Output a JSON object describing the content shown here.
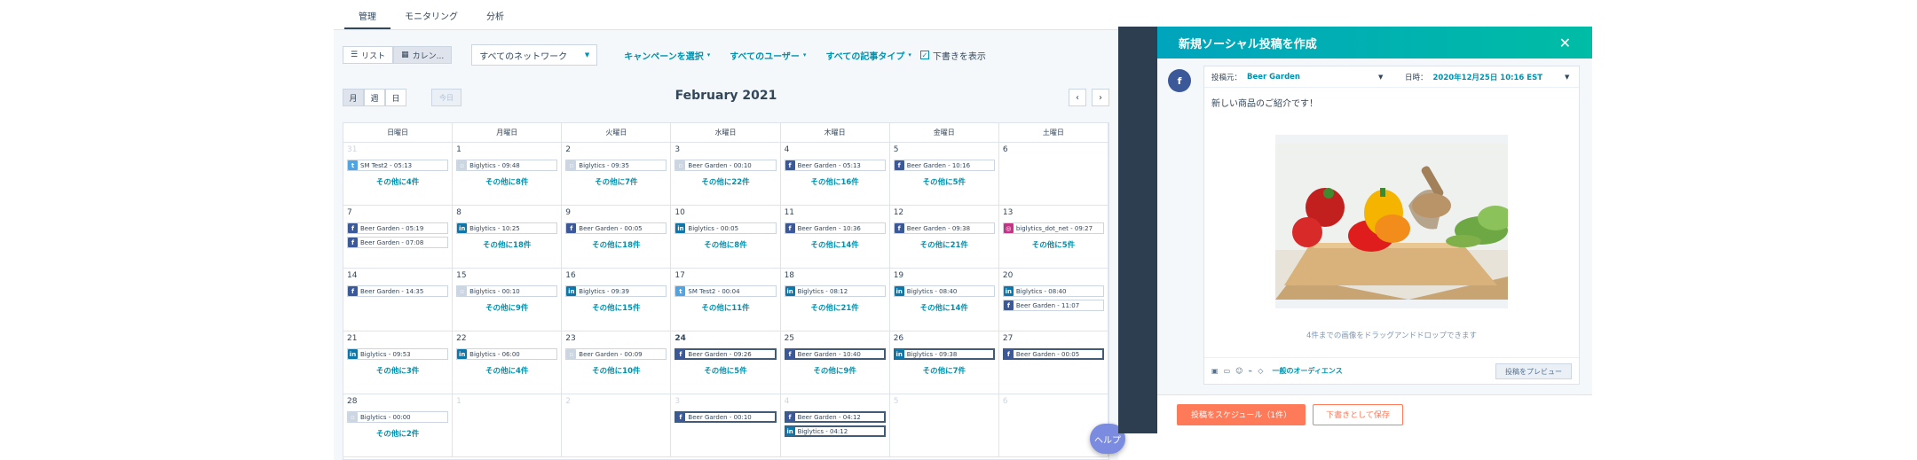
{
  "tabs": [
    {
      "label": "管理"
    },
    {
      "label": "モニタリング"
    },
    {
      "label": "分析"
    }
  ],
  "toolbar": {
    "view_list": "リスト",
    "view_calendar": "カレン...",
    "network": "すべてのネットワーク",
    "campaign": "キャンペーンを選択",
    "users": "すべてのユーザー",
    "post_types": "すべての記事タイプ",
    "show_drafts": "下書きを表示",
    "range_month": "月",
    "range_week": "週",
    "range_day": "日",
    "today": "今日",
    "month_title": "February 2021"
  },
  "weekdays": [
    "日曜日",
    "月曜日",
    "火曜日",
    "水曜日",
    "木曜日",
    "金曜日",
    "土曜日"
  ],
  "calendar": [
    {
      "num": "31",
      "muted": true,
      "posts": [
        {
          "icon": "tw",
          "text": "SM Test2 - 05:13"
        }
      ],
      "more": "その他に4件"
    },
    {
      "num": "1",
      "posts": [
        {
          "icon": "off",
          "text": "Biglytics - 09:48"
        }
      ],
      "more": "その他に8件"
    },
    {
      "num": "2",
      "posts": [
        {
          "icon": "off",
          "text": "Biglytics - 09:35"
        }
      ],
      "more": "その他に7件"
    },
    {
      "num": "3",
      "posts": [
        {
          "icon": "off",
          "text": "Beer Garden - 00:10"
        }
      ],
      "more": "その他に22件"
    },
    {
      "num": "4",
      "posts": [
        {
          "icon": "fb",
          "text": "Beer Garden - 05:13"
        }
      ],
      "more": "その他に16件"
    },
    {
      "num": "5",
      "posts": [
        {
          "icon": "fb",
          "text": "Beer Garden - 10:16"
        }
      ],
      "more": "その他に5件"
    },
    {
      "num": "6",
      "posts": [],
      "more": ""
    },
    {
      "num": "7",
      "posts": [
        {
          "icon": "fb",
          "text": "Beer Garden - 05:19"
        },
        {
          "icon": "fb",
          "text": "Beer Garden - 07:08"
        }
      ],
      "more": ""
    },
    {
      "num": "8",
      "posts": [
        {
          "icon": "li",
          "text": "Biglytics - 10:25"
        }
      ],
      "more": "その他に18件"
    },
    {
      "num": "9",
      "posts": [
        {
          "icon": "fb",
          "text": "Beer Garden - 00:05"
        }
      ],
      "more": "その他に18件"
    },
    {
      "num": "10",
      "posts": [
        {
          "icon": "li",
          "text": "Biglytics - 00:05"
        }
      ],
      "more": "その他に8件"
    },
    {
      "num": "11",
      "posts": [
        {
          "icon": "fb",
          "text": "Beer Garden - 10:36"
        }
      ],
      "more": "その他に14件"
    },
    {
      "num": "12",
      "posts": [
        {
          "icon": "fb",
          "text": "Beer Garden - 09:38"
        }
      ],
      "more": "その他に21件"
    },
    {
      "num": "13",
      "posts": [
        {
          "icon": "ig",
          "text": "biglytics_dot_net - 09:27"
        }
      ],
      "more": "その他に5件"
    },
    {
      "num": "14",
      "posts": [
        {
          "icon": "fb",
          "text": "Beer Garden - 14:35"
        }
      ],
      "more": ""
    },
    {
      "num": "15",
      "posts": [
        {
          "icon": "off",
          "text": "Biglytics - 00:10"
        }
      ],
      "more": "その他に9件"
    },
    {
      "num": "16",
      "posts": [
        {
          "icon": "li",
          "text": "Biglytics - 09:39"
        }
      ],
      "more": "その他に15件"
    },
    {
      "num": "17",
      "posts": [
        {
          "icon": "tw",
          "text": "SM Test2 - 00:04"
        }
      ],
      "more": "その他に11件"
    },
    {
      "num": "18",
      "posts": [
        {
          "icon": "li",
          "text": "Biglytics - 08:12"
        }
      ],
      "more": "その他に21件"
    },
    {
      "num": "19",
      "posts": [
        {
          "icon": "li",
          "text": "Biglytics - 08:40"
        }
      ],
      "more": "その他に14件"
    },
    {
      "num": "20",
      "posts": [
        {
          "icon": "li",
          "text": "Biglytics - 08:40"
        },
        {
          "icon": "fb",
          "text": "Beer Garden - 11:07"
        }
      ],
      "more": ""
    },
    {
      "num": "21",
      "posts": [
        {
          "icon": "li",
          "text": "Biglytics - 09:53"
        }
      ],
      "more": "その他に3件"
    },
    {
      "num": "22",
      "posts": [
        {
          "icon": "li",
          "text": "Biglytics - 06:00"
        }
      ],
      "more": "その他に4件"
    },
    {
      "num": "23",
      "posts": [
        {
          "icon": "off",
          "text": "Beer Garden - 00:09"
        }
      ],
      "more": "その他に10件"
    },
    {
      "num": "24",
      "bold": true,
      "posts": [
        {
          "icon": "fb",
          "text": "Beer Garden - 09:26",
          "sel": true
        }
      ],
      "more": "その他に5件"
    },
    {
      "num": "25",
      "posts": [
        {
          "icon": "fb",
          "text": "Beer Garden - 10:40",
          "sel": true
        }
      ],
      "more": "その他に9件"
    },
    {
      "num": "26",
      "posts": [
        {
          "icon": "li",
          "text": "Biglytics - 09:38",
          "sel": true
        }
      ],
      "more": "その他に7件"
    },
    {
      "num": "27",
      "posts": [
        {
          "icon": "fb",
          "text": "Beer Garden - 00:05",
          "sel": true
        }
      ],
      "more": ""
    },
    {
      "num": "28",
      "posts": [
        {
          "icon": "off",
          "text": "Biglytics - 00:00"
        }
      ],
      "more": "その他に2件"
    },
    {
      "num": "1",
      "muted": true,
      "posts": [],
      "more": ""
    },
    {
      "num": "2",
      "muted": true,
      "posts": [],
      "more": ""
    },
    {
      "num": "3",
      "muted": true,
      "posts": [
        {
          "icon": "fb",
          "text": "Beer Garden - 00:10",
          "sel": true
        }
      ],
      "more": ""
    },
    {
      "num": "4",
      "muted": true,
      "posts": [
        {
          "icon": "fb",
          "text": "Beer Garden - 04:12",
          "sel": true
        },
        {
          "icon": "li",
          "text": "Biglytics - 04:12",
          "sel": true
        }
      ],
      "more": ""
    },
    {
      "num": "5",
      "muted": true,
      "posts": [],
      "more": ""
    },
    {
      "num": "6",
      "muted": true,
      "posts": [],
      "more": ""
    }
  ],
  "help": "ヘルプ",
  "composer": {
    "title": "新規ソーシャル投稿を作成",
    "close": "✕",
    "from_label": "投稿元：",
    "from_value": "Beer Garden",
    "date_label": "日時：",
    "date_value": "2020年12月25日 10:16 EST",
    "text": "新しい商品のご紹介です！",
    "drop_hint": "4件までの画像をドラッグアンドドロップできます",
    "audience": "一般のオーディエンス",
    "preview": "投稿をプレビュー",
    "schedule": "投稿をスケジュール（1件）",
    "save_draft": "下書きとして保存"
  }
}
